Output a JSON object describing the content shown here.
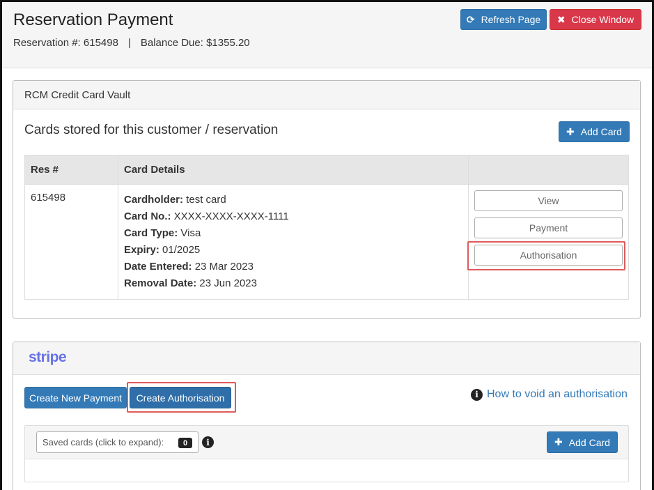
{
  "header": {
    "title": "Reservation Payment",
    "reservation_label": "Reservation #: 615498",
    "separator": "|",
    "balance_label": "Balance Due: $1355.20",
    "refresh_label": "Refresh Page",
    "close_label": "Close Window"
  },
  "vault": {
    "title": "RCM Credit Card Vault",
    "heading": "Cards stored for this customer / reservation",
    "add_card_label": "Add Card",
    "columns": [
      "Res #",
      "Card Details",
      ""
    ],
    "rows": [
      {
        "res": "615498",
        "details": [
          {
            "label": "Cardholder:",
            "value": " test card"
          },
          {
            "label": "Card No.:",
            "value": " XXXX-XXXX-XXXX-1111"
          },
          {
            "label": "Card Type:",
            "value": " Visa"
          },
          {
            "label": "Expiry:",
            "value": " 01/2025"
          },
          {
            "label": "Date Entered:",
            "value": " 23 Mar 2023"
          },
          {
            "label": "Removal Date:",
            "value": " 23 Jun 2023"
          }
        ],
        "actions": [
          "View",
          "Payment",
          "Authorisation"
        ]
      }
    ]
  },
  "stripe": {
    "logo": "stripe",
    "create_payment_label": "Create New Payment",
    "create_auth_label": "Create Authorisation",
    "void_link": "How to void an authorisation",
    "saved_cards_label": "Saved cards (click to expand):",
    "saved_cards_count": "0",
    "add_card_label": "Add Card"
  },
  "colors": {
    "primary": "#337ab7",
    "danger": "#d9384a",
    "highlight": "#e05a5a",
    "stripe": "#6772e5"
  }
}
